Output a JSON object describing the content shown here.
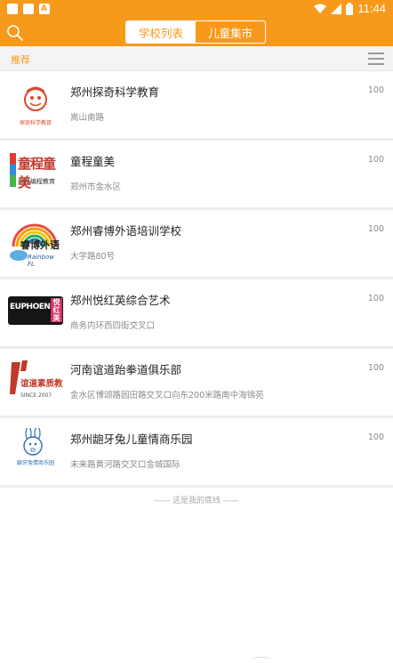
{
  "status_bar": {
    "time": "11:44"
  },
  "header": {
    "tabs": [
      {
        "label": "学校列表",
        "active": true
      },
      {
        "label": "儿童集市",
        "active": false
      }
    ]
  },
  "subbar": {
    "label": "推荐"
  },
  "schools": [
    {
      "name": "郑州探奇科学教育",
      "address": "嵩山南路",
      "score": "100",
      "logo_text": "探奇科学教育"
    },
    {
      "name": "童程童美",
      "address": "郑州市金水区",
      "score": "100",
      "logo_text": "童程童美",
      "logo_sub": "少儿编程教育"
    },
    {
      "name": "郑州睿博外语培训学校",
      "address": "大学路80号",
      "score": "100",
      "logo_text": "睿博外语",
      "logo_sub": "Rainbow FL"
    },
    {
      "name": "郑州悦红英综合艺术",
      "address": "商务内环西四街交叉口",
      "score": "100",
      "logo_text": "EUPHOENIX",
      "logo_sub": "悦红英"
    },
    {
      "name": "河南谊道跆拳道俱乐部",
      "address": "金水区博颂路园田路交叉口向东200米路南中海锦苑",
      "score": "100",
      "logo_text": "谊道素质教育",
      "logo_sub": "SINCE 2007"
    },
    {
      "name": "郑州龅牙兔儿童情商乐园",
      "address": "未来路黄河路交叉口金城国际",
      "score": "100",
      "logo_text": "龅牙兔情商乐园"
    }
  ],
  "footer": {
    "text": "—— 这是我的底线 ——"
  },
  "colors": {
    "accent": "#f79a1c",
    "divider": "#ececec"
  }
}
